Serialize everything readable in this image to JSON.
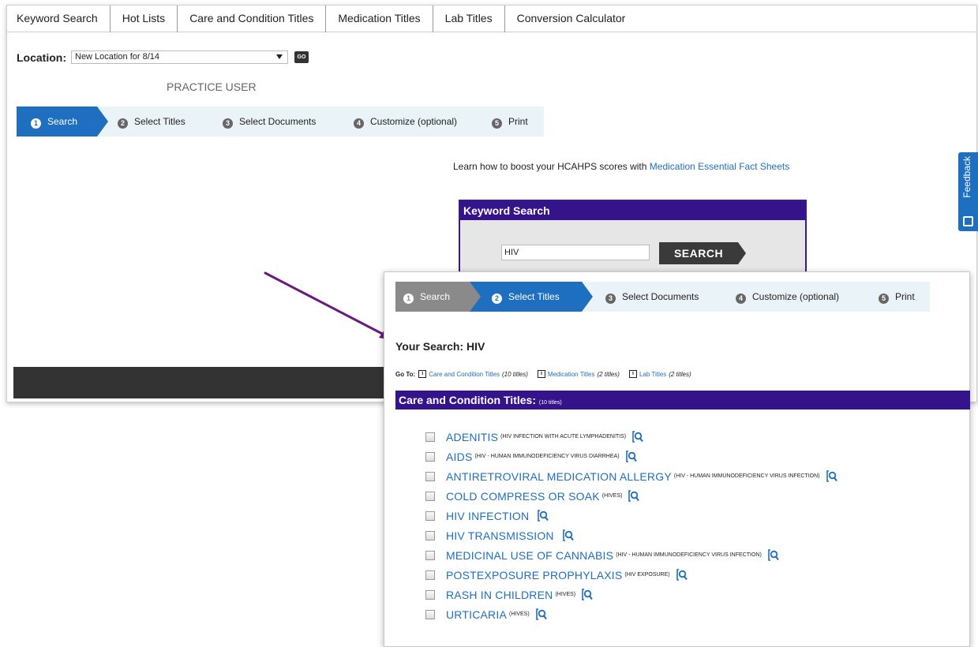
{
  "topnav": {
    "items": [
      "Keyword Search",
      "Hot Lists",
      "Care and Condition Titles",
      "Medication Titles",
      "Lab Titles",
      "Conversion Calculator"
    ]
  },
  "location": {
    "label": "Location:",
    "selected": "New Location for 8/14",
    "go_label": "GO"
  },
  "user": {
    "name": "PRACTICE USER"
  },
  "base_steps": [
    {
      "num": "1",
      "label": "Search",
      "state": "active"
    },
    {
      "num": "2",
      "label": "Select Titles",
      "state": "pending"
    },
    {
      "num": "3",
      "label": "Select Documents",
      "state": "pending"
    },
    {
      "num": "4",
      "label": "Customize (optional)",
      "state": "pending"
    },
    {
      "num": "5",
      "label": "Print",
      "state": "pending"
    }
  ],
  "promo": {
    "text": "Learn how to boost your HCAHPS scores with",
    "link": "Medication Essential Fact Sheets"
  },
  "keyword_search": {
    "heading": "Keyword Search",
    "value": "HIV",
    "button": "SEARCH"
  },
  "feedback": {
    "label": "Feedback"
  },
  "overlay": {
    "steps": [
      {
        "num": "1",
        "label": "Search",
        "state": "done"
      },
      {
        "num": "2",
        "label": "Select Titles",
        "state": "active"
      },
      {
        "num": "3",
        "label": "Select Documents",
        "state": "pending"
      },
      {
        "num": "4",
        "label": "Customize (optional)",
        "state": "pending"
      },
      {
        "num": "5",
        "label": "Print",
        "state": "pending"
      }
    ],
    "your_search_label": "Your Search:",
    "your_search_value": "HIV",
    "goto": {
      "label": "Go To:",
      "links": [
        {
          "text": "Care and Condition Titles",
          "count": "(10 titles)"
        },
        {
          "text": "Medication Titles",
          "count": "(2 titles)"
        },
        {
          "text": "Lab Titles",
          "count": "(2 titles)"
        }
      ]
    },
    "section": {
      "title": "Care and Condition Titles:",
      "count": "(10 titles)"
    },
    "titles": [
      {
        "name": "ADENITIS",
        "synonym": "(HIV INFECTION WITH ACUTE LYMPHADENITIS)"
      },
      {
        "name": "AIDS",
        "synonym": "(HIV - HUMAN IMMUNODEFICIENCY VIRUS DIARRHEA)"
      },
      {
        "name": "ANTIRETROVIRAL MEDICATION ALLERGY",
        "synonym": "(HIV - HUMAN IMMUNODEFICIENCY VIRUS INFECTION)"
      },
      {
        "name": "COLD COMPRESS OR SOAK",
        "synonym": "(HIVES)"
      },
      {
        "name": "HIV INFECTION",
        "synonym": ""
      },
      {
        "name": "HIV TRANSMISSION",
        "synonym": ""
      },
      {
        "name": "MEDICINAL USE OF CANNABIS",
        "synonym": "(HIV - HUMAN IMMUNODEFICIENCY VIRUS INFECTION)"
      },
      {
        "name": "POSTEXPOSURE PROPHYLAXIS",
        "synonym": "(HIV EXPOSURE)"
      },
      {
        "name": "RASH IN CHILDREN",
        "synonym": "(HIVES)"
      },
      {
        "name": "URTICARIA",
        "synonym": "(HIVES)"
      }
    ]
  },
  "colors": {
    "accent_blue": "#1e6fbf",
    "header_purple": "#35138a",
    "annotation_arrow": "#6a1b7a"
  }
}
